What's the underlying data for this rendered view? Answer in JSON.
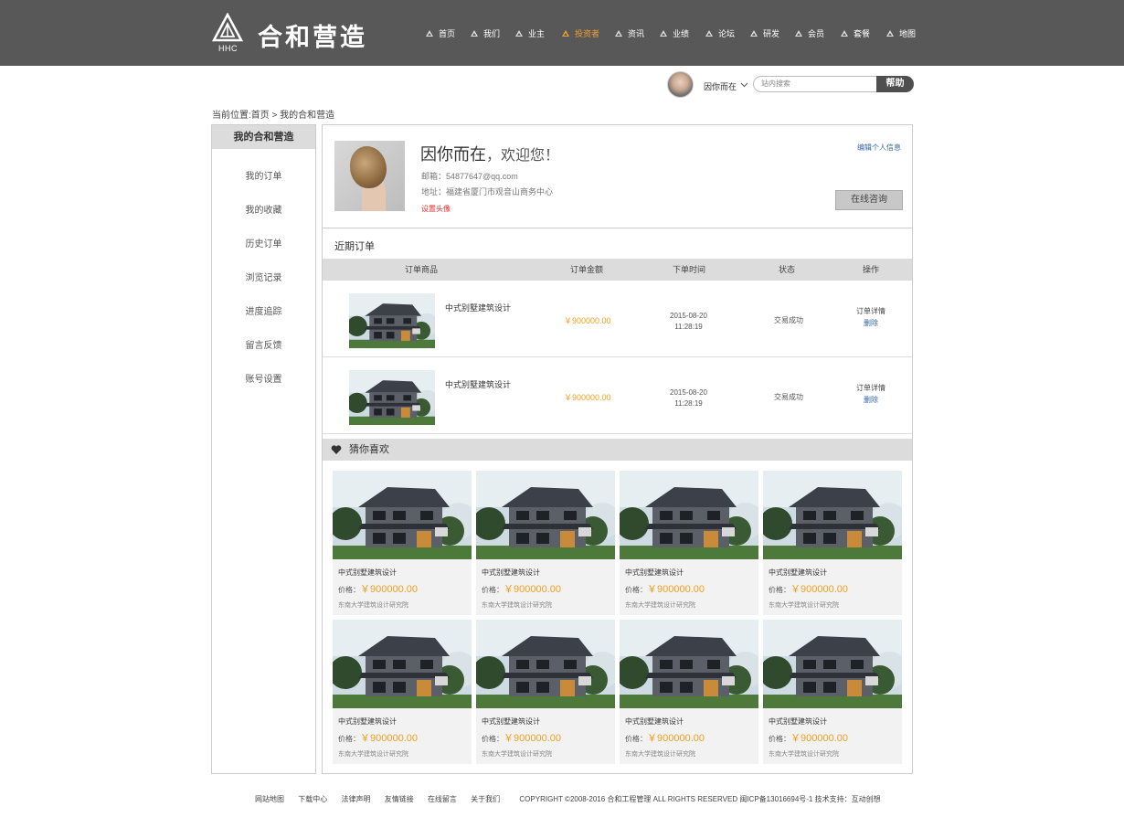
{
  "header": {
    "logo_abbr": "HHC",
    "logo_text": "合和营造",
    "nav": [
      {
        "label": "首页",
        "active": false
      },
      {
        "label": "我们",
        "active": false
      },
      {
        "label": "业主",
        "active": false
      },
      {
        "label": "投资者",
        "active": true
      },
      {
        "label": "资讯",
        "active": false
      },
      {
        "label": "业绩",
        "active": false
      },
      {
        "label": "论坛",
        "active": false
      },
      {
        "label": "研发",
        "active": false
      },
      {
        "label": "会员",
        "active": false
      },
      {
        "label": "套餐",
        "active": false
      },
      {
        "label": "地图",
        "active": false
      }
    ]
  },
  "userbar": {
    "username": "因你而在",
    "search_placeholder": "站内搜索",
    "help_label": "帮助"
  },
  "breadcrumb": "当前位置:首页 > 我的合和营造",
  "sidebar": {
    "title": "我的合和营造",
    "items": [
      "我的订单",
      "我的收藏",
      "历史订单",
      "浏览记录",
      "进度追踪",
      "留言反馈",
      "账号设置"
    ]
  },
  "profile": {
    "name": "因你而在",
    "welcome": "，欢迎您！",
    "email": "邮箱：54877647@qq.com",
    "address": "地址：福建省厦门市观音山商务中心",
    "set_avatar": "设置头像",
    "edit_info": "编辑个人信息",
    "consult_button": "在线咨询"
  },
  "orders": {
    "title": "近期订单",
    "columns": [
      "订单商品",
      "订单金额",
      "下单时间",
      "状态",
      "操作"
    ],
    "rows": [
      {
        "name": "中式别墅建筑设计",
        "price": "￥900000.00",
        "date": "2015-08-20",
        "time": "11:28:19",
        "status": "交易成功",
        "detail": "订单详情",
        "delete": "删除"
      },
      {
        "name": "中式别墅建筑设计",
        "price": "￥900000.00",
        "date": "2015-08-20",
        "time": "11:28:19",
        "status": "交易成功",
        "detail": "订单详情",
        "delete": "删除"
      }
    ]
  },
  "guess": {
    "title": "猜你喜欢",
    "items": [
      {
        "name": "中式别墅建筑设计",
        "price_label": "价格：",
        "price": "￥900000.00",
        "org": "东南大学建筑设计研究院"
      },
      {
        "name": "中式别墅建筑设计",
        "price_label": "价格：",
        "price": "￥900000.00",
        "org": "东南大学建筑设计研究院"
      },
      {
        "name": "中式别墅建筑设计",
        "price_label": "价格：",
        "price": "￥900000.00",
        "org": "东南大学建筑设计研究院"
      },
      {
        "name": "中式别墅建筑设计",
        "price_label": "价格：",
        "price": "￥900000.00",
        "org": "东南大学建筑设计研究院"
      },
      {
        "name": "中式别墅建筑设计",
        "price_label": "价格：",
        "price": "￥900000.00",
        "org": "东南大学建筑设计研究院"
      },
      {
        "name": "中式别墅建筑设计",
        "price_label": "价格：",
        "price": "￥900000.00",
        "org": "东南大学建筑设计研究院"
      },
      {
        "name": "中式别墅建筑设计",
        "price_label": "价格：",
        "price": "￥900000.00",
        "org": "东南大学建筑设计研究院"
      },
      {
        "name": "中式别墅建筑设计",
        "price_label": "价格：",
        "price": "￥900000.00",
        "org": "东南大学建筑设计研究院"
      }
    ]
  },
  "footer": {
    "links": [
      "网站地图",
      "下载中心",
      "法律声明",
      "友情链接",
      "在线留言",
      "关于我们"
    ],
    "copyright": "COPYRIGHT ©2008-2016 合和工程管理 ALL RIGHTS RESERVED 闽ICP备13016694号-1 技术支持：互动创想"
  },
  "colors": {
    "header_bg": "#585858",
    "accent": "#f0a020",
    "link_blue": "#3366aa",
    "alert_red": "#e03030",
    "panel_gray": "#dcdcdc"
  }
}
